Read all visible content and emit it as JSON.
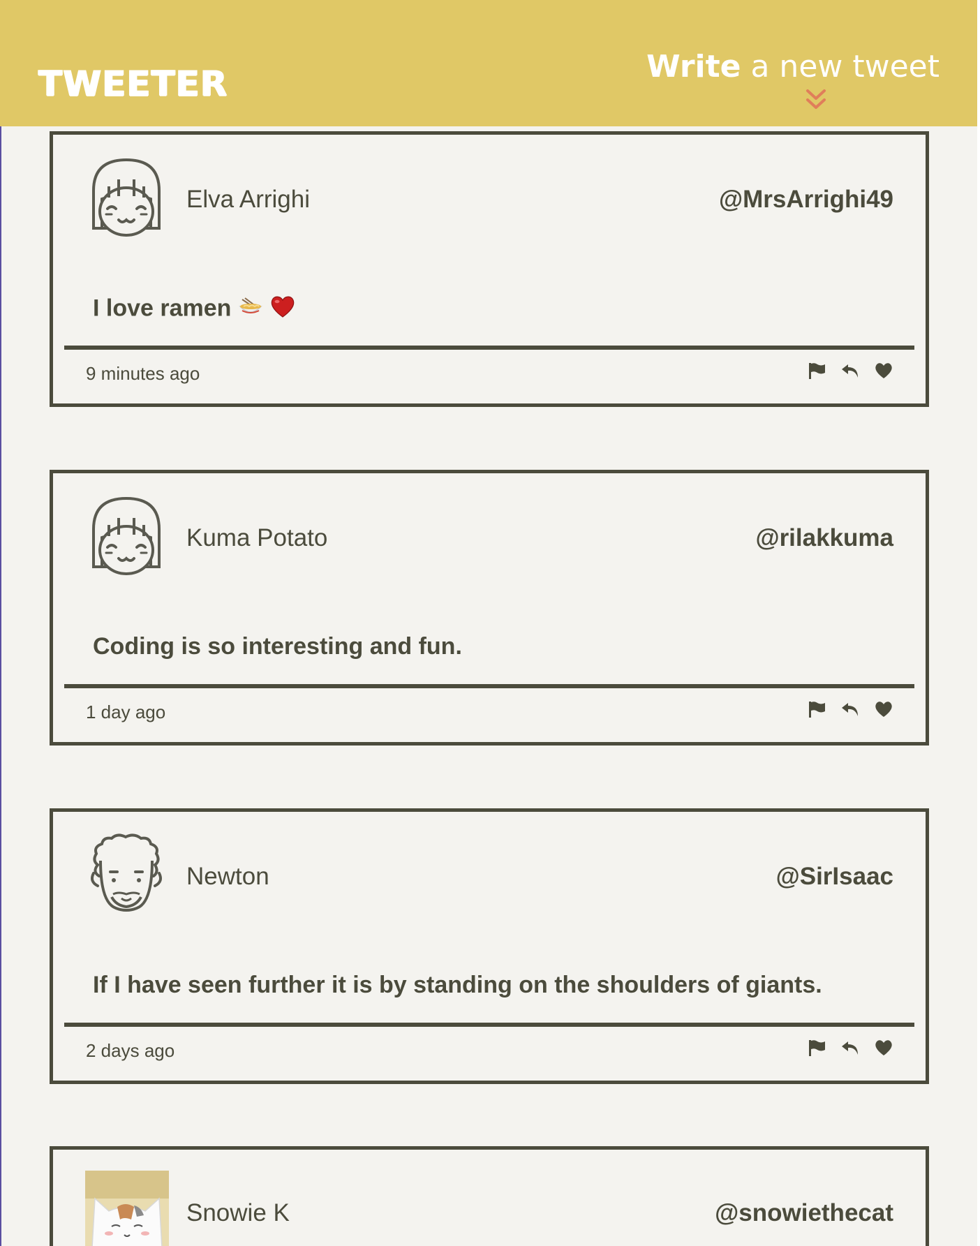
{
  "brand": {
    "name": "TWEETER"
  },
  "compose": {
    "strong": "Write",
    "rest": "a new tweet",
    "icon": "double-chevron-down-icon"
  },
  "colors": {
    "header": "#e0c866",
    "ink": "#4b4b3c",
    "background": "#f4f3ef",
    "chevron": "#e07e5a"
  },
  "tweets": [
    {
      "name": "Elva Arrighi",
      "handle": "@MrsArrighi49",
      "text": "I love ramen",
      "emojis": [
        "ramen-bowl-emoji",
        "red-heart-emoji"
      ],
      "time": "9 minutes ago",
      "avatar": "girl-face-avatar"
    },
    {
      "name": "Kuma Potato",
      "handle": "@rilakkuma",
      "text": "Coding is so interesting and fun.",
      "time": "1 day ago",
      "avatar": "girl-face-avatar"
    },
    {
      "name": "Newton",
      "handle": "@SirIsaac",
      "text": "If I have seen further it is by standing on the shoulders of giants.",
      "time": "2 days ago",
      "avatar": "curly-hair-face-avatar"
    },
    {
      "name": "Snowie K",
      "handle": "@snowiethecat",
      "avatar": "cat-photo-avatar"
    }
  ],
  "actions": [
    "flag-icon",
    "retweet-icon",
    "heart-icon"
  ]
}
